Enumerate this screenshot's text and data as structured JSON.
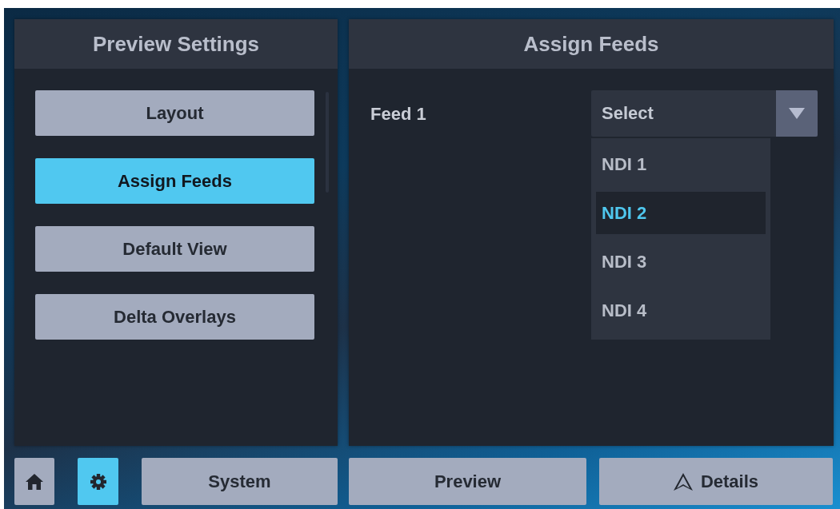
{
  "settings_panel": {
    "title": "Preview Settings",
    "items": [
      {
        "label": "Layout",
        "selected": false
      },
      {
        "label": "Assign Feeds",
        "selected": true
      },
      {
        "label": "Default View",
        "selected": false
      },
      {
        "label": "Delta Overlays",
        "selected": false
      }
    ]
  },
  "feeds_panel": {
    "title": "Assign Feeds",
    "feeds": [
      {
        "label": "Feed 1",
        "value": "Select",
        "expanded": true,
        "options": [
          {
            "label": "NDI 1",
            "selected": false
          },
          {
            "label": "NDI 2",
            "selected": true
          },
          {
            "label": "NDI 3",
            "selected": false
          },
          {
            "label": "NDI 4",
            "selected": false
          }
        ]
      }
    ]
  },
  "bottom_bar": [
    {
      "kind": "home",
      "selected": false
    },
    {
      "kind": "gear",
      "selected": true
    },
    {
      "kind": "text",
      "label": "System",
      "selected": false
    },
    {
      "kind": "text",
      "label": "Preview",
      "selected": false
    },
    {
      "kind": "delta",
      "label": "Details",
      "selected": false
    }
  ]
}
